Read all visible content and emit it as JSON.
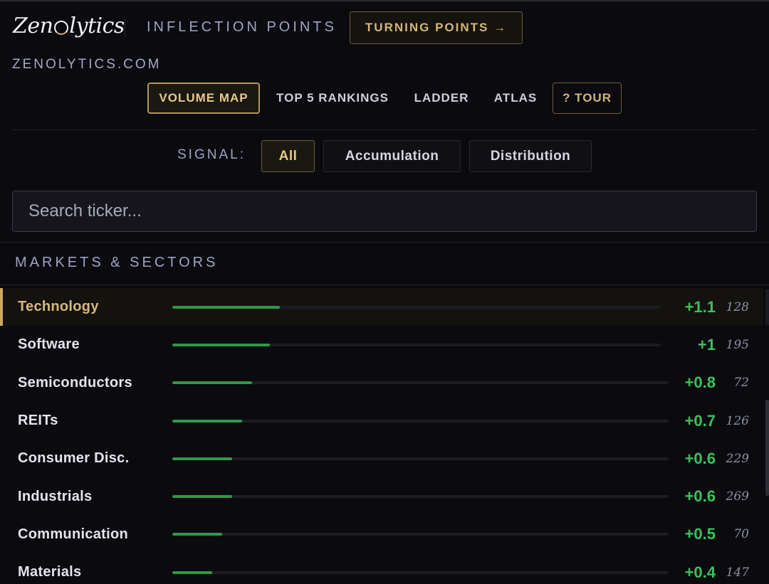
{
  "header": {
    "logo_left": "Zen",
    "logo_right": "lytics",
    "inflection": "INFLECTION POINTS",
    "turning_points": "TURNING POINTS →",
    "site": "ZENOLYTICS.COM"
  },
  "nav": {
    "volume_map": "VOLUME MAP",
    "top5": "TOP 5 RANKINGS",
    "ladder": "LADDER",
    "atlas": "ATLAS",
    "tour": "? TOUR"
  },
  "signal": {
    "label": "SIGNAL:",
    "all": "All",
    "accumulation": "Accumulation",
    "distribution": "Distribution"
  },
  "search": {
    "placeholder": "Search ticker..."
  },
  "section": {
    "title": "MARKETS & SECTORS"
  },
  "colors": {
    "accent_gold": "#c9a766",
    "positive_green": "#38c35a",
    "bar_green": "#2e9a45"
  },
  "rows": [
    {
      "name": "Technology",
      "value": "+1.1",
      "count": "128",
      "fill": 0.22
    },
    {
      "name": "Software",
      "value": "+1",
      "count": "195",
      "fill": 0.2
    },
    {
      "name": "Semiconductors",
      "value": "+0.8",
      "count": "72",
      "fill": 0.16
    },
    {
      "name": "REITs",
      "value": "+0.7",
      "count": "126",
      "fill": 0.14
    },
    {
      "name": "Consumer Disc.",
      "value": "+0.6",
      "count": "229",
      "fill": 0.12
    },
    {
      "name": "Industrials",
      "value": "+0.6",
      "count": "269",
      "fill": 0.12
    },
    {
      "name": "Communication",
      "value": "+0.5",
      "count": "70",
      "fill": 0.1
    },
    {
      "name": "Materials",
      "value": "+0.4",
      "count": "147",
      "fill": 0.08
    }
  ]
}
